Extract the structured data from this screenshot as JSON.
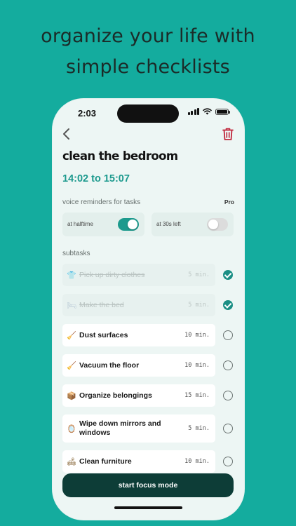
{
  "headline": {
    "line1": "organize your life with",
    "line2": "simple checklists"
  },
  "status_bar": {
    "time": "2:03"
  },
  "screen": {
    "title": "clean the bedroom",
    "time_range": "14:02 to 15:07",
    "voice_section": {
      "label": "voice reminders for tasks",
      "badge": "Pro"
    },
    "toggles": [
      {
        "label": "at halftime",
        "on": true
      },
      {
        "label": "at 30s left",
        "on": false
      }
    ],
    "subtasks_label": "subtasks",
    "tasks": [
      {
        "emoji": "👕",
        "name": "Pick up dirty clothes",
        "duration": "5 min.",
        "done": true
      },
      {
        "emoji": "🛏",
        "name": "Make the bed",
        "duration": "5 min.",
        "done": true
      },
      {
        "emoji": "🧹",
        "name": "Dust surfaces",
        "duration": "10 min.",
        "done": false
      },
      {
        "emoji": "🧹",
        "name": "Vacuum the floor",
        "duration": "10 min.",
        "done": false
      },
      {
        "emoji": "📦",
        "name": "Organize belongings",
        "duration": "15 min.",
        "done": false
      },
      {
        "emoji": "🪞",
        "name": "Wipe down mirrors and windows",
        "duration": "5 min.",
        "done": false
      },
      {
        "emoji": "🛋",
        "name": "Clean furniture",
        "duration": "10 min.",
        "done": false
      }
    ],
    "cta_label": "start focus mode"
  },
  "colors": {
    "background": "#14ac9e",
    "accent": "#1c9a8d",
    "cta": "#0d3d37",
    "danger": "#c0263b"
  }
}
